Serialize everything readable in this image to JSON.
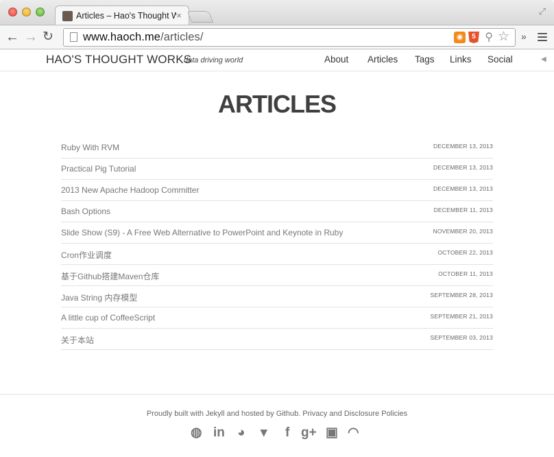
{
  "browser": {
    "tab_title": "Articles – Hao's Thought W",
    "tab_close": "×",
    "url_domain": "www.haoch.me",
    "url_path": "/articles/",
    "icons": [
      "back-arrow-icon",
      "forward-arrow-icon",
      "reload-icon",
      "rss-icon",
      "html5-icon",
      "search-icon",
      "star-icon",
      "menu-icon"
    ]
  },
  "site": {
    "brand": "HAO'S THOUGHT WORKS",
    "tagline": "data driving world",
    "nav": [
      "About",
      "Articles",
      "Tags",
      "Links",
      "Social"
    ]
  },
  "page": {
    "title": "ARTICLES"
  },
  "posts": [
    {
      "title": "Ruby With RVM",
      "date": "DECEMBER 13, 2013"
    },
    {
      "title": "Practical Pig Tutorial",
      "date": "DECEMBER 13, 2013"
    },
    {
      "title": "2013 New Apache Hadoop Committer",
      "date": "DECEMBER 13, 2013"
    },
    {
      "title": "Bash Options",
      "date": "DECEMBER 11, 2013"
    },
    {
      "title": "Slide Show (S9) - A Free Web Alternative to PowerPoint and Keynote in Ruby",
      "date": "NOVEMBER 20, 2013"
    },
    {
      "title": "Cron作业调度",
      "date": "OCTOBER 22, 2013"
    },
    {
      "title": "基于Github搭建Maven仓库",
      "date": "OCTOBER 11, 2013"
    },
    {
      "title": "Java String 内存模型",
      "date": "SEPTEMBER 28, 2013"
    },
    {
      "title": "A little cup of CoffeeScript",
      "date": "SEPTEMBER 21, 2013"
    },
    {
      "title": "关于本站",
      "date": "SEPTEMBER 03, 2013"
    }
  ],
  "footer": {
    "text": "Proudly built with Jekyll and hosted by Github. Privacy and Disclosure Policies",
    "socials": [
      "github-icon",
      "linkedin-icon",
      "weibo-icon",
      "twitter-icon",
      "facebook-icon",
      "google-plus-icon",
      "instagram-icon",
      "rss-icon"
    ]
  },
  "colors": {
    "text_muted": "#777777",
    "title": "#3f3f3f",
    "rss": "#f28a1a",
    "html5": "#e4532a"
  }
}
